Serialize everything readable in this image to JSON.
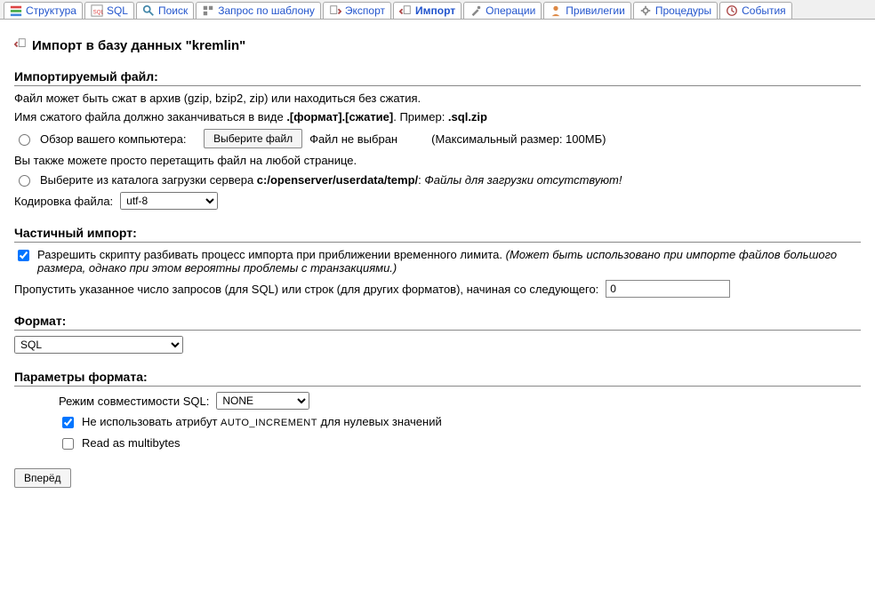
{
  "tabs": [
    {
      "label": "Структура"
    },
    {
      "label": "SQL"
    },
    {
      "label": "Поиск"
    },
    {
      "label": "Запрос по шаблону"
    },
    {
      "label": "Экспорт"
    },
    {
      "label": "Импорт"
    },
    {
      "label": "Операции"
    },
    {
      "label": "Привилегии"
    },
    {
      "label": "Процедуры"
    },
    {
      "label": "События"
    }
  ],
  "heading": "Импорт в базу данных \"kremlin\"",
  "file": {
    "title": "Импортируемый файл:",
    "hint1": "Файл может быть сжат в архив (gzip, bzip2, zip) или находиться без сжатия.",
    "hint2a": "Имя сжатого файла должно заканчиваться в виде ",
    "hint2b": ".[формат].[сжатие]",
    "hint2c": ". Пример: ",
    "hint2d": ".sql.zip",
    "browseLabel": "Обзор вашего компьютера:",
    "chooseBtn": "Выберите файл",
    "noFile": "Файл не выбран",
    "maxSize": "(Максимальный размер: 100МБ)",
    "dragHint": "Вы также можете просто перетащить файл на любой странице.",
    "serverLabelA": "Выберите из каталога загрузки сервера ",
    "serverPath": "c:/openserver/userdata/temp/",
    "serverLabelB": ": ",
    "serverEmpty": "Файлы для загрузки отсутствуют!",
    "charsetLabel": "Кодировка файла:",
    "charsetValue": "utf-8"
  },
  "partial": {
    "title": "Частичный импорт:",
    "allowLabel": "Разрешить скрипту разбивать процесс импорта при приближении временного лимита. ",
    "allowNote": "(Может быть использовано при импорте файлов большого размера, однако при этом вероятны проблемы с транзакциями.)",
    "skipLabel": "Пропустить указанное число запросов (для SQL) или строк (для других форматов), начиная со следующего:",
    "skipValue": "0"
  },
  "format": {
    "title": "Формат:",
    "value": "SQL"
  },
  "params": {
    "title": "Параметры формата:",
    "compatLabel": "Режим совместимости SQL:",
    "compatValue": "NONE",
    "noAutoA": "Не использовать атрибут ",
    "noAutoB": "AUTO_INCREMENT",
    "noAutoC": " для нулевых значений",
    "readMulti": "Read as multibytes"
  },
  "submit": "Вперёд"
}
